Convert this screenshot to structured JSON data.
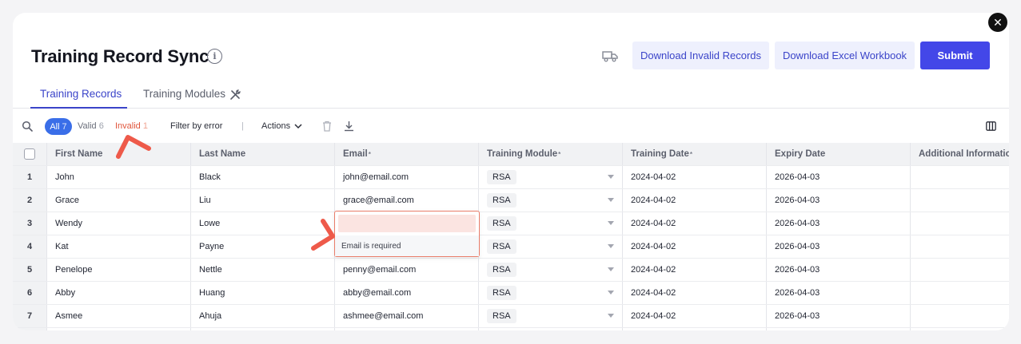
{
  "title": "Training Record Sync",
  "buttons": {
    "download_invalid": "Download Invalid Records",
    "download_excel": "Download Excel Workbook",
    "submit": "Submit"
  },
  "tabs": [
    {
      "label": "Training Records",
      "active": true
    },
    {
      "label": "Training Modules",
      "active": false
    }
  ],
  "toolbar": {
    "all_label": "All",
    "all_count": "7",
    "valid_label": "Valid",
    "valid_count": "6",
    "invalid_label": "Invalid",
    "invalid_count": "1",
    "filter_by_error": "Filter by error",
    "separator": "|",
    "actions": "Actions"
  },
  "table": {
    "headers": {
      "first_name": "First Name",
      "last_name": "Last Name",
      "email": "Email",
      "training_module": "Training Module",
      "training_date": "Training Date",
      "expiry_date": "Expiry Date",
      "additional_information": "Additional Information",
      "required_mark": "*"
    },
    "rows": [
      {
        "num": "1",
        "first": "John",
        "last": "Black",
        "email": "john@email.com",
        "module": "RSA",
        "tdate": "2024-04-02",
        "edate": "2026-04-03"
      },
      {
        "num": "2",
        "first": "Grace",
        "last": "Liu",
        "email": "grace@email.com",
        "module": "RSA",
        "tdate": "2024-04-02",
        "edate": "2026-04-03"
      },
      {
        "num": "3",
        "first": "Wendy",
        "last": "Lowe",
        "email": "",
        "module": "RSA",
        "tdate": "2024-04-02",
        "edate": "2026-04-03"
      },
      {
        "num": "4",
        "first": "Kat",
        "last": "Payne",
        "email": "",
        "module": "RSA",
        "tdate": "2024-04-02",
        "edate": "2026-04-03"
      },
      {
        "num": "5",
        "first": "Penelope",
        "last": "Nettle",
        "email": "penny@email.com",
        "module": "RSA",
        "tdate": "2024-04-02",
        "edate": "2026-04-03"
      },
      {
        "num": "6",
        "first": "Abby",
        "last": "Huang",
        "email": "abby@email.com",
        "module": "RSA",
        "tdate": "2024-04-02",
        "edate": "2026-04-03"
      },
      {
        "num": "7",
        "first": "Asmee",
        "last": "Ahuja",
        "email": "ashmee@email.com",
        "module": "RSA",
        "tdate": "2024-04-02",
        "edate": "2026-04-03"
      }
    ]
  },
  "email_error": {
    "message": "Email is required"
  },
  "icons": {
    "close": "close-icon",
    "info": "info-icon",
    "truck": "truck-icon",
    "tools": "tools-icon",
    "search": "search-icon",
    "trash": "trash-icon",
    "download": "download-icon",
    "columns": "columns-icon"
  },
  "colors": {
    "primary": "#4347e8",
    "accent": "#3b44c9",
    "error": "#e0553b",
    "annotation": "#ee5a4a"
  }
}
